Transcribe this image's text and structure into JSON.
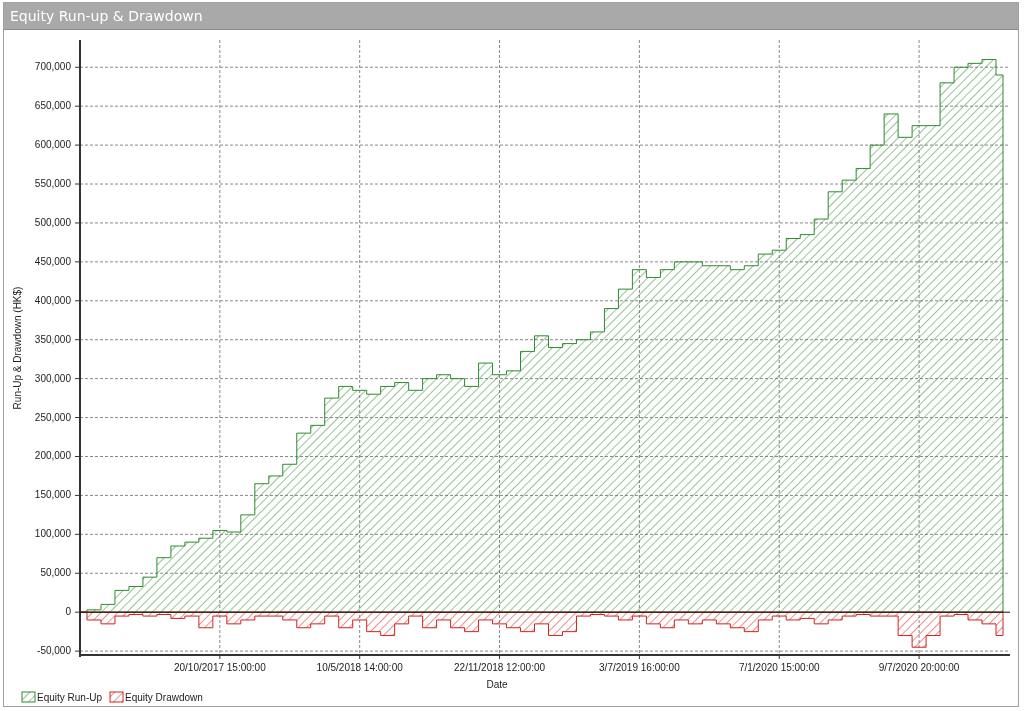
{
  "panel": {
    "title": "Equity Run-up & Drawdown"
  },
  "chart": {
    "chart_data": {
      "type": "area",
      "xlabel": "Date",
      "ylabel": "Run-Up & Drawdown (HK$)",
      "categories": [
        null,
        null,
        null,
        null,
        null,
        null,
        null,
        null,
        null,
        null,
        "20/10/2017 15:00:00",
        null,
        null,
        null,
        null,
        null,
        null,
        null,
        null,
        null,
        "10/5/2018 14:00:00",
        null,
        null,
        null,
        null,
        null,
        null,
        null,
        null,
        null,
        "22/11/2018 12:00:00",
        null,
        null,
        null,
        null,
        null,
        null,
        null,
        null,
        null,
        "3/7/2019 16:00:00",
        null,
        null,
        null,
        null,
        null,
        null,
        null,
        null,
        null,
        "7/1/2020 15:00:00",
        null,
        null,
        null,
        null,
        null,
        null,
        null,
        null,
        null,
        "9/7/2020 20:00:00",
        null,
        null,
        null,
        null,
        null,
        null
      ],
      "ylim": [
        -55000,
        735000
      ],
      "grid": true,
      "legend": "bottom",
      "yticks": [
        {
          "value": -50000,
          "label": "-50,000"
        },
        {
          "value": 0,
          "label": "0"
        },
        {
          "value": 50000,
          "label": "50,000"
        },
        {
          "value": 100000,
          "label": "100,000"
        },
        {
          "value": 150000,
          "label": "150,000"
        },
        {
          "value": 200000,
          "label": "200,000"
        },
        {
          "value": 250000,
          "label": "250,000"
        },
        {
          "value": 300000,
          "label": "300,000"
        },
        {
          "value": 350000,
          "label": "350,000"
        },
        {
          "value": 400000,
          "label": "400,000"
        },
        {
          "value": 450000,
          "label": "450,000"
        },
        {
          "value": 500000,
          "label": "500,000"
        },
        {
          "value": 550000,
          "label": "550,000"
        },
        {
          "value": 600000,
          "label": "600,000"
        },
        {
          "value": 650000,
          "label": "650,000"
        },
        {
          "value": 700000,
          "label": "700,000"
        }
      ],
      "series": [
        {
          "name": "Equity Run-Up",
          "color": "#2e8b2e",
          "values": [
            0,
            3000,
            10000,
            28000,
            33000,
            45000,
            70000,
            85000,
            90000,
            95000,
            105000,
            103000,
            125000,
            165000,
            175000,
            190000,
            230000,
            240000,
            275000,
            290000,
            285000,
            280000,
            290000,
            295000,
            285000,
            300000,
            305000,
            300000,
            290000,
            320000,
            305000,
            310000,
            335000,
            355000,
            340000,
            345000,
            350000,
            360000,
            390000,
            415000,
            440000,
            430000,
            440000,
            450000,
            450000,
            445000,
            445000,
            440000,
            445000,
            460000,
            465000,
            480000,
            485000,
            505000,
            540000,
            555000,
            570000,
            600000,
            640000,
            610000,
            625000,
            625000,
            680000,
            700000,
            705000,
            710000,
            690000
          ]
        },
        {
          "name": "Equity Drawdown",
          "color": "#d42020",
          "values": [
            0,
            -10000,
            -15000,
            -5000,
            -3000,
            -5000,
            -3000,
            -8000,
            -5000,
            -20000,
            -5000,
            -15000,
            -10000,
            -5000,
            -5000,
            -10000,
            -20000,
            -15000,
            -5000,
            -20000,
            -10000,
            -25000,
            -30000,
            -15000,
            -5000,
            -20000,
            -10000,
            -20000,
            -25000,
            -10000,
            -15000,
            -20000,
            -25000,
            -15000,
            -30000,
            -25000,
            -5000,
            -3000,
            -5000,
            -10000,
            -5000,
            -15000,
            -20000,
            -10000,
            -15000,
            -10000,
            -15000,
            -20000,
            -25000,
            -10000,
            -5000,
            -10000,
            -8000,
            -15000,
            -10000,
            -5000,
            -3000,
            -5000,
            -5000,
            -30000,
            -45000,
            -30000,
            -5000,
            -3000,
            -10000,
            -15000,
            -30000
          ]
        }
      ]
    }
  }
}
